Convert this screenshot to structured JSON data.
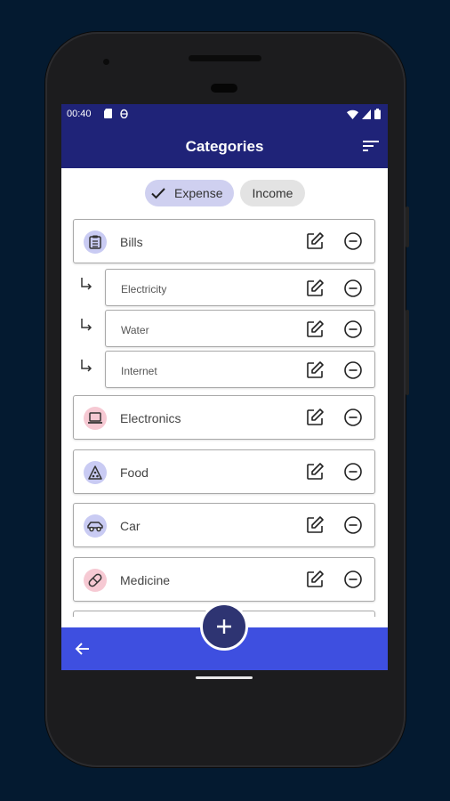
{
  "status": {
    "time": "00:40"
  },
  "app": {
    "title": "Categories"
  },
  "tabs": {
    "expense": "Expense",
    "income": "Income"
  },
  "categories": [
    {
      "label": "Bills",
      "icon": "clipboard-icon",
      "icon_bg": "#c9cbf3"
    },
    {
      "label": "Electricity",
      "parent": "Bills"
    },
    {
      "label": "Water",
      "parent": "Bills"
    },
    {
      "label": "Internet",
      "parent": "Bills"
    },
    {
      "label": "Electronics",
      "icon": "laptop-icon",
      "icon_bg": "#f6c9d3"
    },
    {
      "label": "Food",
      "icon": "pizza-icon",
      "icon_bg": "#c9cbf3"
    },
    {
      "label": "Car",
      "icon": "car-icon",
      "icon_bg": "#c9cbf3"
    },
    {
      "label": "Medicine",
      "icon": "pill-icon",
      "icon_bg": "#f6c9d3"
    }
  ],
  "colors": {
    "appbar": "#1f2378",
    "bottombar": "#3e4fe0",
    "fab": "#2e3472",
    "chip_selected": "#cfd0f0",
    "chip_unselected": "#e3e3e3"
  }
}
